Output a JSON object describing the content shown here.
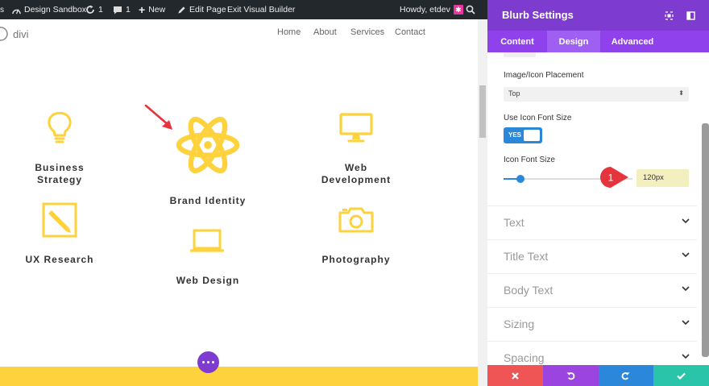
{
  "admin_bar": {
    "site_name": "Design Sandbox",
    "updates_count": "1",
    "comments_count": "1",
    "new_label": "New",
    "edit_page_label": "Edit Page",
    "exit_label": "Exit Visual Builder",
    "howdy": "Howdy, etdev"
  },
  "site": {
    "logo_text": "divi",
    "nav": [
      "Home",
      "About",
      "Services",
      "Contact"
    ]
  },
  "blurbs": [
    {
      "title": "Business Strategy",
      "icon": "lightbulb-icon"
    },
    {
      "title": "Brand Identity",
      "icon": "atom-icon"
    },
    {
      "title": "Web Development",
      "icon": "monitor-icon"
    },
    {
      "title": "UX Research",
      "icon": "pencil-icon"
    },
    {
      "title": "Web Design",
      "icon": "laptop-icon"
    },
    {
      "title": "Photography",
      "icon": "camera-icon"
    }
  ],
  "panel": {
    "title": "Blurb Settings",
    "tabs": [
      "Content",
      "Design",
      "Advanced"
    ],
    "active_tab": "Design",
    "placement_label": "Image/Icon Placement",
    "placement_value": "Top",
    "use_icon_font_size_label": "Use Icon Font Size",
    "toggle_value": "YES",
    "icon_font_size_label": "Icon Font Size",
    "icon_font_size_value": "120px",
    "annotation_number": "1",
    "groups": [
      "Text",
      "Title Text",
      "Body Text",
      "Sizing",
      "Spacing"
    ]
  },
  "colors": {
    "accent": "#fdd23d",
    "purple": "#7d3bcf",
    "blue": "#2b87da",
    "cancel": "#ef5555",
    "undo": "#9b44e0",
    "redo": "#2b87da",
    "save": "#29c4a9"
  }
}
